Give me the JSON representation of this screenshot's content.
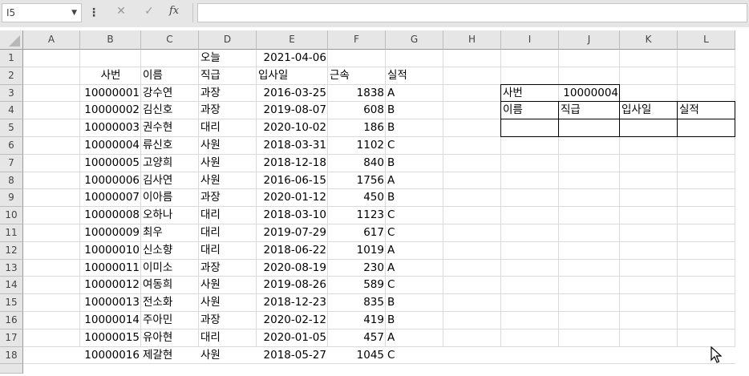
{
  "formula_bar": {
    "name_box": "I5",
    "cancel_icon": "✕",
    "enter_icon": "✓",
    "fx_label": "fx",
    "formula": ""
  },
  "columns": [
    "A",
    "B",
    "C",
    "D",
    "E",
    "F",
    "G",
    "H",
    "I",
    "J",
    "K",
    "L"
  ],
  "rows": [
    "1",
    "2",
    "3",
    "4",
    "5",
    "6",
    "7",
    "8",
    "9",
    "10",
    "11",
    "12",
    "13",
    "14",
    "15",
    "16",
    "17",
    "18"
  ],
  "sheet": {
    "today_label": "오늘",
    "today_value": "2021-04-06",
    "headers": {
      "id": "사번",
      "name": "이름",
      "rank": "직급",
      "hire_date": "입사일",
      "tenure": "근속",
      "performance": "실적"
    },
    "records": [
      {
        "id": "10000001",
        "name": "강수연",
        "rank": "과장",
        "hire_date": "2016-03-25",
        "tenure": "1838",
        "performance": "A"
      },
      {
        "id": "10000002",
        "name": "김신호",
        "rank": "과장",
        "hire_date": "2019-08-07",
        "tenure": "608",
        "performance": "B"
      },
      {
        "id": "10000003",
        "name": "권수현",
        "rank": "대리",
        "hire_date": "2020-10-02",
        "tenure": "186",
        "performance": "B"
      },
      {
        "id": "10000004",
        "name": "류신호",
        "rank": "사원",
        "hire_date": "2018-03-31",
        "tenure": "1102",
        "performance": "C"
      },
      {
        "id": "10000005",
        "name": "고양희",
        "rank": "사원",
        "hire_date": "2018-12-18",
        "tenure": "840",
        "performance": "B"
      },
      {
        "id": "10000006",
        "name": "김사연",
        "rank": "사원",
        "hire_date": "2016-06-15",
        "tenure": "1756",
        "performance": "A"
      },
      {
        "id": "10000007",
        "name": "이아름",
        "rank": "과장",
        "hire_date": "2020-01-12",
        "tenure": "450",
        "performance": "B"
      },
      {
        "id": "10000008",
        "name": "오하나",
        "rank": "대리",
        "hire_date": "2018-03-10",
        "tenure": "1123",
        "performance": "C"
      },
      {
        "id": "10000009",
        "name": "최우",
        "rank": "대리",
        "hire_date": "2019-07-29",
        "tenure": "617",
        "performance": "C"
      },
      {
        "id": "10000010",
        "name": "신소향",
        "rank": "대리",
        "hire_date": "2018-06-22",
        "tenure": "1019",
        "performance": "A"
      },
      {
        "id": "10000011",
        "name": "이미소",
        "rank": "과장",
        "hire_date": "2020-08-19",
        "tenure": "230",
        "performance": "A"
      },
      {
        "id": "10000012",
        "name": "여동희",
        "rank": "사원",
        "hire_date": "2019-08-26",
        "tenure": "589",
        "performance": "C"
      },
      {
        "id": "10000013",
        "name": "전소화",
        "rank": "사원",
        "hire_date": "2018-12-23",
        "tenure": "835",
        "performance": "B"
      },
      {
        "id": "10000014",
        "name": "주아민",
        "rank": "과장",
        "hire_date": "2020-02-12",
        "tenure": "419",
        "performance": "B"
      },
      {
        "id": "10000015",
        "name": "유아현",
        "rank": "대리",
        "hire_date": "2020-01-05",
        "tenure": "457",
        "performance": "A"
      },
      {
        "id": "10000016",
        "name": "제갈현",
        "rank": "사원",
        "hire_date": "2018-05-27",
        "tenure": "1045",
        "performance": "C"
      }
    ],
    "lookup": {
      "id_label": "사번",
      "id_value": "10000004",
      "headers": [
        "이름",
        "직급",
        "입사일",
        "실적"
      ],
      "results": [
        "",
        "",
        "",
        ""
      ]
    }
  }
}
